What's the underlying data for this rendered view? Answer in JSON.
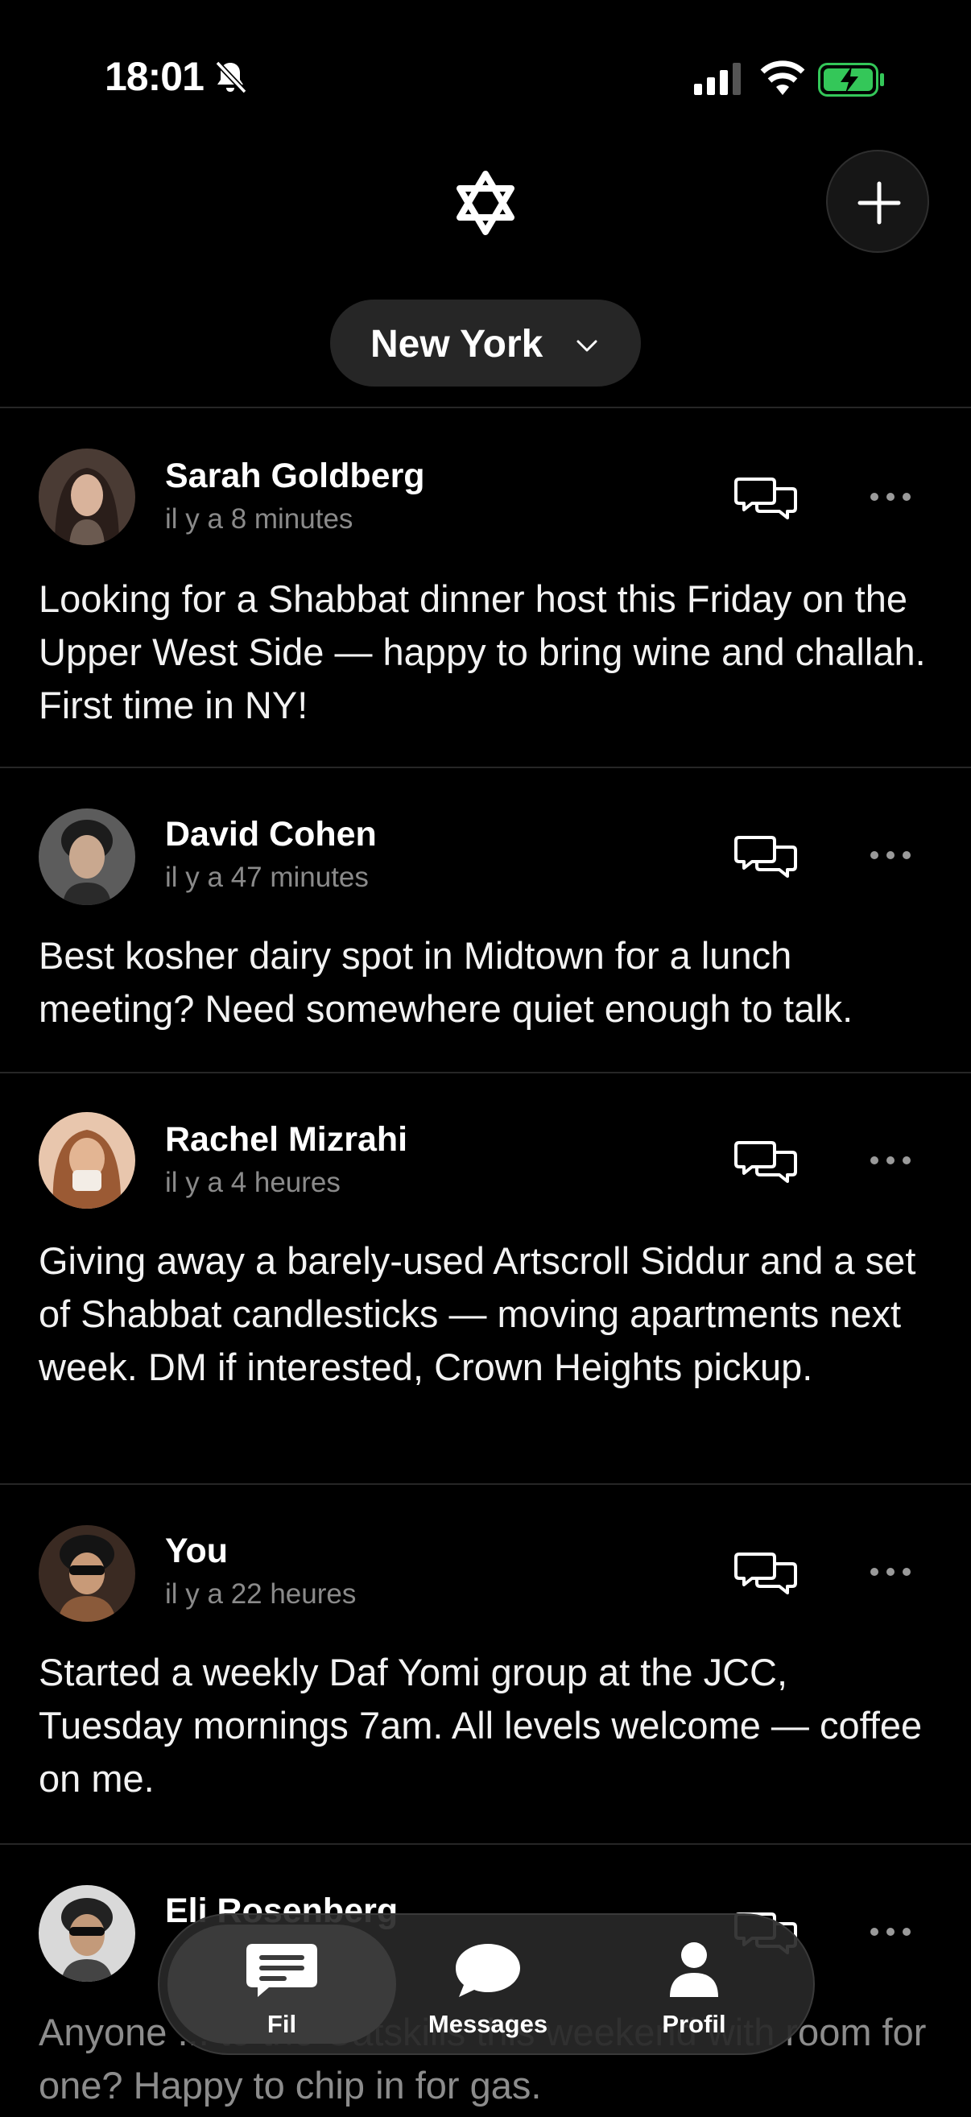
{
  "status_bar": {
    "time": "18:01"
  },
  "header": {
    "city": "New York"
  },
  "posts": [
    {
      "name": "Sarah Goldberg",
      "time_ago": "il y a 8 minutes",
      "body": "Looking for a Shabbat dinner host this Friday on the Upper West Side — happy to bring wine and challah. First time in NY!"
    },
    {
      "name": "David Cohen",
      "time_ago": "il y a 47 minutes",
      "body": "Best kosher dairy spot in Midtown for a lunch meeting? Need somewhere quiet enough to talk."
    },
    {
      "name": "Rachel Mizrahi",
      "time_ago": "il y a 4 heures",
      "body": "Giving away a barely-used Artscroll Siddur and a set of Shabbat candlesticks — moving apartments next week. DM if interested, Crown Heights pickup."
    },
    {
      "name": "You",
      "time_ago": "il y a 22 heures",
      "body": "Started a weekly Daf Yomi group at the JCC, Tuesday mornings 7am. All levels welcome — coffee on me."
    },
    {
      "name": "Eli Rosenberg",
      "time_ago": "",
      "body": "Anyone ... to the Catskills this weekend with room for one? Happy to chip in for gas."
    }
  ],
  "tabs": [
    {
      "label": "Fil",
      "icon": "feed-icon",
      "active": true
    },
    {
      "label": "Messages",
      "icon": "chat-bubble-icon",
      "active": false
    },
    {
      "label": "Profil",
      "icon": "person-icon",
      "active": false
    }
  ],
  "colors": {
    "background": "#000000",
    "secondary_text": "#8a8a8a",
    "battery": "#34c759"
  }
}
